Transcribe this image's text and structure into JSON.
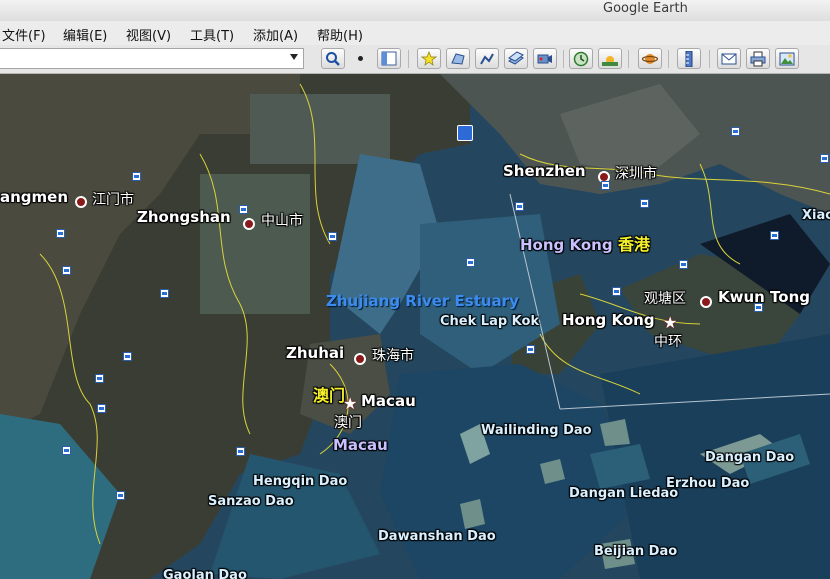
{
  "window": {
    "title": "Google Earth"
  },
  "menu": [
    {
      "label": "文件(F)"
    },
    {
      "label": "编辑(E)"
    },
    {
      "label": "视图(V)"
    },
    {
      "label": "工具(T)"
    },
    {
      "label": "添加(A)"
    },
    {
      "label": "帮助(H)"
    }
  ],
  "toolbar": {
    "search_value": "",
    "buttons": [
      "search-icon",
      "sidebar-toggle-icon",
      "placemark-icon",
      "polygon-icon",
      "path-icon",
      "image-overlay-icon",
      "record-tour-icon",
      "historical-imagery-icon",
      "sunlight-icon",
      "planets-icon",
      "ruler-icon",
      "email-icon",
      "print-icon",
      "save-image-icon"
    ]
  },
  "map": {
    "labels": {
      "jiangmen_en": "angmen",
      "jiangmen_zh": "江门市",
      "zhongshan_en": "Zhongshan",
      "zhongshan_zh": "中山市",
      "shenzhen_en": "Shenzhen",
      "shenzhen_zh": "深圳市",
      "hongkong_region_en": "Hong Kong",
      "hongkong_region_zh": "香港",
      "xiao": "Xiao",
      "estuary": "Zhujiang River Estuary",
      "chek_lap_kok": "Chek Lap Kok",
      "kwun_tong_zh": "观塘区",
      "kwun_tong_en": "Kwun Tong",
      "hongkong_city": "Hong Kong",
      "central_zh": "中环",
      "zhuhai_en": "Zhuhai",
      "zhuhai_zh": "珠海市",
      "macau_zh_yellow": "澳门",
      "macau_en": "Macau",
      "macau_zh": "澳门",
      "macau_region": "Macau",
      "wailingding": "Wailinding Dao",
      "dangan": "Dangan Dao",
      "hengqin": "Hengqin Dao",
      "sanzao": "Sanzao Dao",
      "dangan_liedao": "Dangan Liedao",
      "erzhou": "Erzhou Dao",
      "dawanshan": "Dawanshan Dao",
      "beijian": "Beijian Dao",
      "gaolan": "Gaolan Dao"
    }
  }
}
